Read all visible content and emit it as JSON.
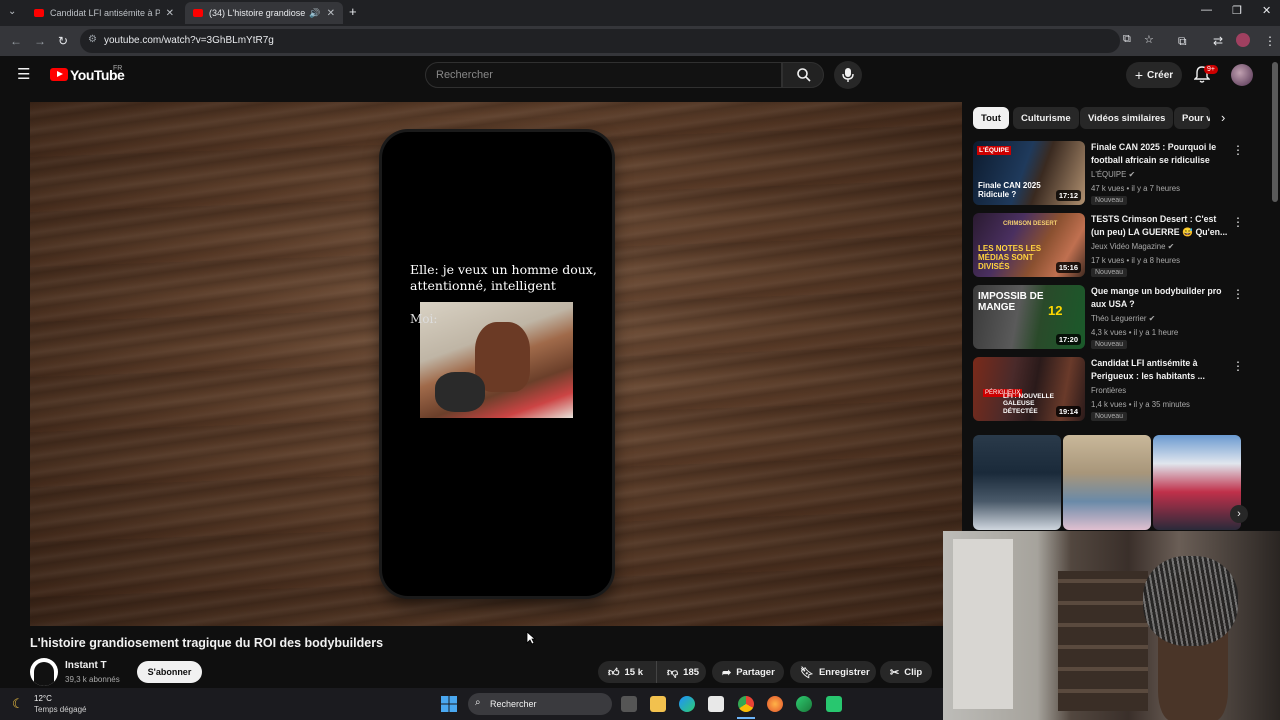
{
  "browser": {
    "tabs": [
      {
        "title": "Candidat LFI antisémite à Perig",
        "active": false
      },
      {
        "title": "(34) L'histoire grandioseme",
        "active": true
      }
    ],
    "url": "youtube.com/watch?v=3GhBLmYtR7g"
  },
  "youtube": {
    "logo": "YouTube",
    "region": "FR",
    "search_placeholder": "Rechercher",
    "create_label": "Créer",
    "notif_count": "9+"
  },
  "video": {
    "overlay_text": "Elle: je veux un homme doux, attentionné, intelligent",
    "overlay_moi": "Moi:",
    "title": "L'histoire grandiosement tragique du ROI des bodybuilders",
    "channel": "Instant T",
    "subscribers": "39,3 k abonnés",
    "subscribe_label": "S'abonner",
    "likes": "15 k",
    "dislikes": "185",
    "share_label": "Partager",
    "save_label": "Enregistrer",
    "clip_label": "Clip"
  },
  "sidebar": {
    "chips": [
      "Tout",
      "Culturisme",
      "Vidéos similaires",
      "Pour v"
    ],
    "recommendations": [
      {
        "title": "Finale CAN 2025 : Pourquoi le football africain se ridiculise",
        "channel": "L'ÉQUIPE",
        "meta": "47 k vues • il y a 7 heures",
        "badge": "Nouveau",
        "duration": "17:12",
        "thumb_text": "Finale CAN 2025 Ridicule ?",
        "thumb_tag": "L'ÉQUIPE"
      },
      {
        "title": "TESTS Crimson Desert : C'est (un peu) LA GUERRE 😅 Qu'en...",
        "channel": "Jeux Vidéo Magazine",
        "meta": "17 k vues • il y a 8 heures",
        "badge": "Nouveau",
        "duration": "15:16",
        "thumb_text": "LES NOTES LES MÉDIAS SONT DIVISÉS",
        "thumb_tag": "CRIMSON DESERT"
      },
      {
        "title": "Que mange un bodybuilder pro aux USA ?",
        "channel": "Théo Leguerrier",
        "meta": "4,3 k vues • il y a 1 heure",
        "badge": "Nouveau",
        "duration": "17:20",
        "thumb_text": "IMPOSSIB DE MANGE",
        "thumb_tag": "12"
      },
      {
        "title": "Candidat LFI antisémite à Perigueux : les habitants ...",
        "channel": "Frontières",
        "meta": "1,4 k vues • il y a 35 minutes",
        "badge": "Nouveau",
        "duration": "19:14",
        "thumb_text": "LFI : NOUVELLE GALEUSE DÉTECTÉE",
        "thumb_tag": "PÉRIGUEUX"
      }
    ]
  },
  "taskbar": {
    "temperature": "12°C",
    "weather": "Temps dégagé",
    "search_label": "Rechercher"
  },
  "colors": {
    "yt_red": "#ff0000",
    "bg": "#0f0f0f",
    "chip_bg": "#272727"
  }
}
